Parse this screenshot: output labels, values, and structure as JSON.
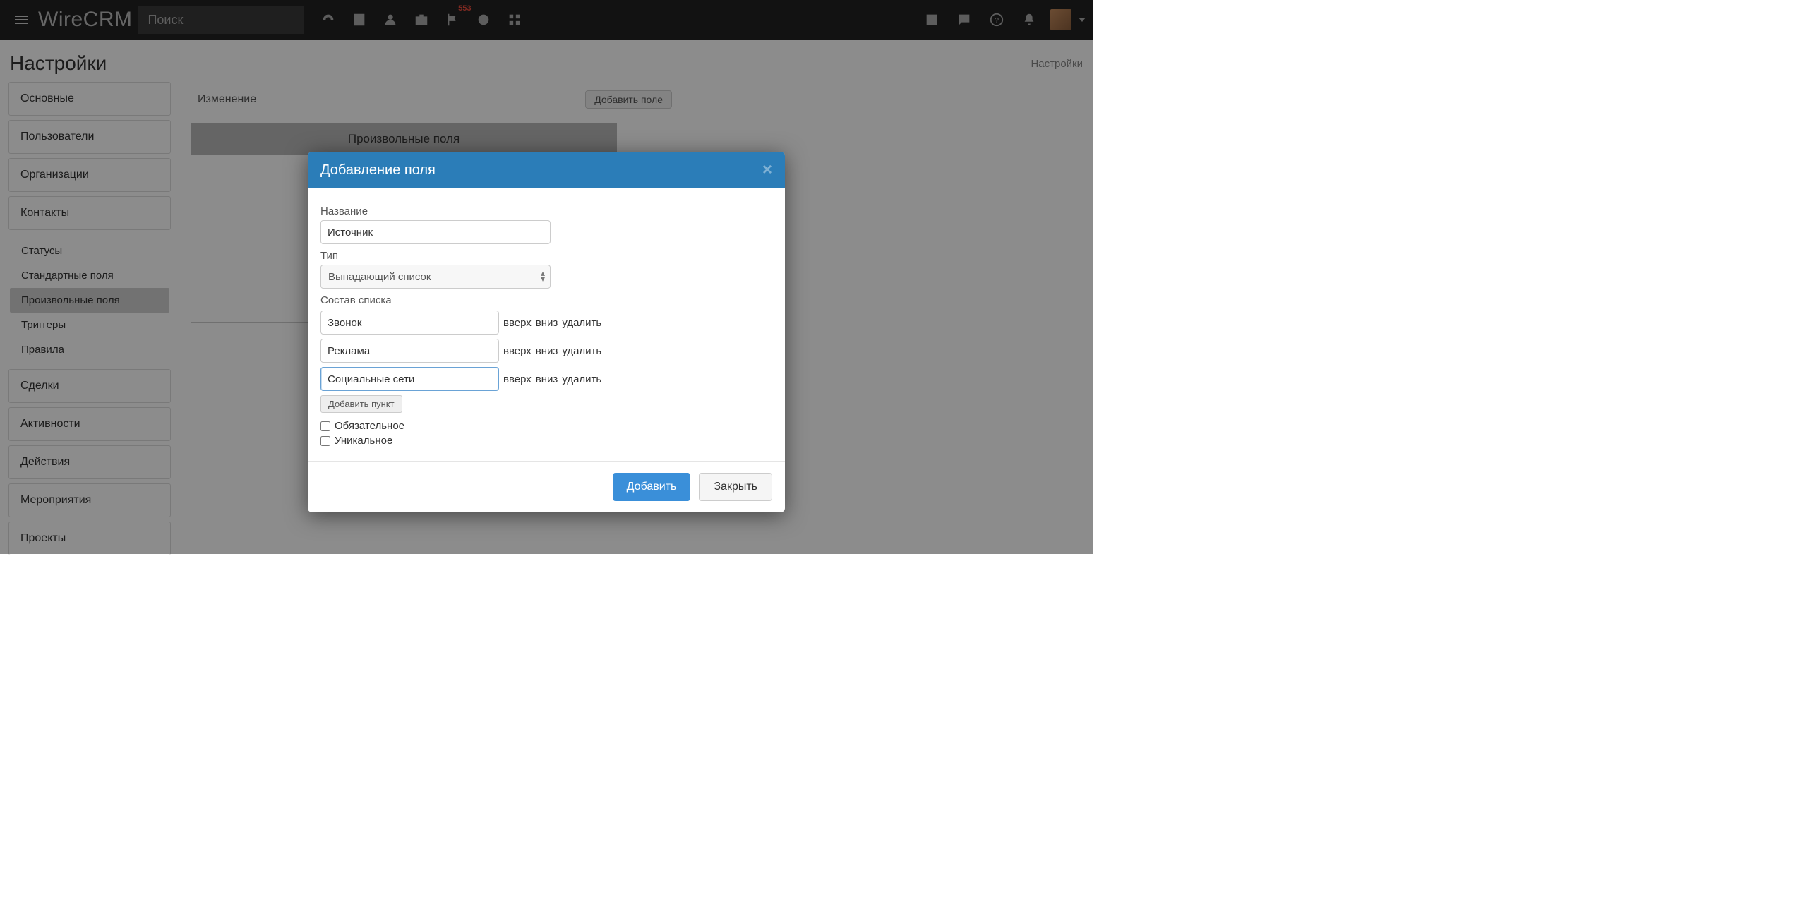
{
  "header": {
    "brand": "WireCRM",
    "search_placeholder": "Поиск",
    "badge_count": "553"
  },
  "page": {
    "title": "Настройки",
    "breadcrumb": "Настройки"
  },
  "sidebar": {
    "items": [
      "Основные",
      "Пользователи",
      "Организации",
      "Контакты",
      "Сделки",
      "Активности",
      "Действия",
      "Мероприятия",
      "Проекты"
    ],
    "sub": {
      "items": [
        "Статусы",
        "Стандартные поля",
        "Произвольные поля",
        "Триггеры",
        "Правила"
      ],
      "active_index": 2
    }
  },
  "content": {
    "section_label": "Изменение",
    "add_field_btn": "Добавить поле",
    "panel_title": "Произвольные поля"
  },
  "modal": {
    "title": "Добавление поля",
    "name_label": "Название",
    "name_value": "Источник",
    "type_label": "Тип",
    "type_value": "Выпадающий список",
    "list_label": "Состав списка",
    "list_items": [
      "Звонок",
      "Реклама",
      "Социальные сети"
    ],
    "row_actions": {
      "up": "вверх",
      "down": "вниз",
      "del": "удалить"
    },
    "add_item_btn": "Добавить пункт",
    "required_label": "Обязательное",
    "unique_label": "Уникальное",
    "submit": "Добавить",
    "cancel": "Закрыть"
  }
}
